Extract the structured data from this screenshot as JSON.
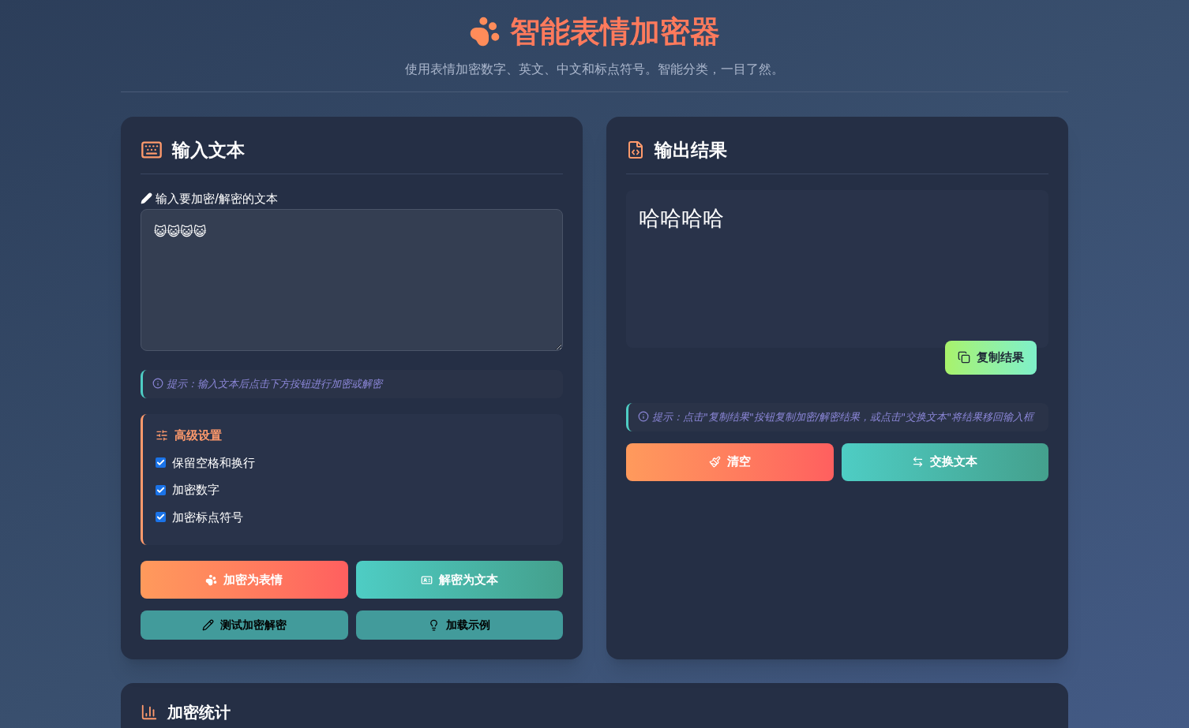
{
  "header": {
    "title": "智能表情加密器",
    "subtitle": "使用表情加密数字、英文、中文和标点符号。智能分类，一目了然。"
  },
  "input_panel": {
    "title": "输入文本",
    "field_label": "输入要加密/解密的文本",
    "value": "😺😺😺😺",
    "tip": "提示：输入文本后点击下方按钮进行加密或解密",
    "settings": {
      "title": "高级设置",
      "options": [
        {
          "label": "保留空格和换行",
          "checked": true
        },
        {
          "label": "加密数字",
          "checked": true
        },
        {
          "label": "加密标点符号",
          "checked": true
        }
      ]
    },
    "primary_buttons": [
      {
        "kind": "encrypt",
        "label": "加密为表情"
      },
      {
        "kind": "decrypt",
        "label": "解密为文本"
      }
    ],
    "secondary_buttons": [
      {
        "kind": "test",
        "label": "测试加密解密"
      },
      {
        "kind": "example",
        "label": "加载示例"
      }
    ]
  },
  "output_panel": {
    "title": "输出结果",
    "result": "哈哈哈哈",
    "copy_button": "复制结果",
    "tip": "提示：点击\"复制结果\"按钮复制加密/解密结果，或点击\"交换文本\"将结果移回输入框",
    "buttons": [
      {
        "kind": "clear",
        "label": "清空"
      },
      {
        "kind": "swap",
        "label": "交换文本"
      }
    ]
  },
  "stats_panel": {
    "title": "加密统计"
  }
}
